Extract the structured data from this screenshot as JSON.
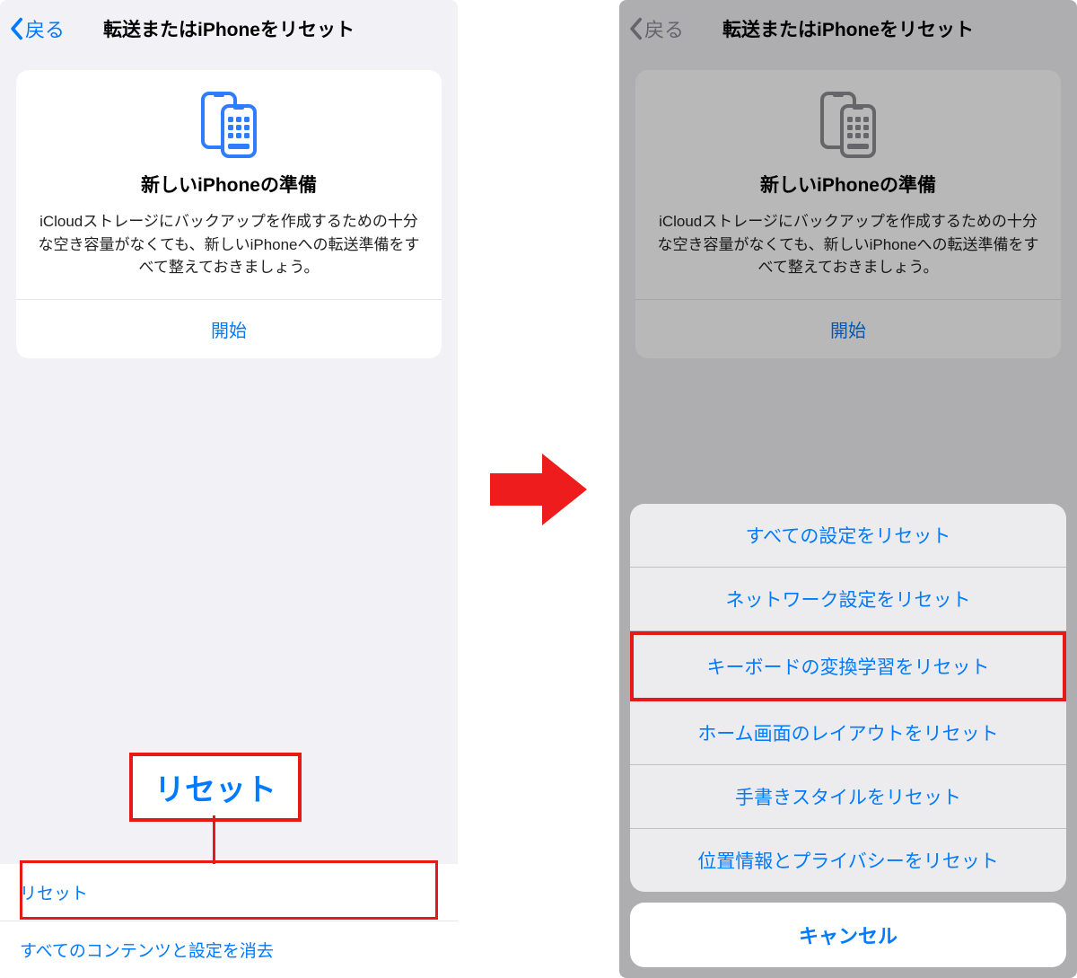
{
  "left": {
    "back_label": "戻る",
    "title": "転送またはiPhoneをリセット",
    "card": {
      "heading": "新しいiPhoneの準備",
      "description": "iCloudストレージにバックアップを作成するための十分な空き容量がなくても、新しいiPhoneへの転送準備をすべて整えておきましょう。",
      "action": "開始"
    },
    "callout_label": "リセット",
    "rows": {
      "reset": "リセット",
      "erase": "すべてのコンテンツと設定を消去"
    }
  },
  "right": {
    "back_label": "戻る",
    "title": "転送またはiPhoneをリセット",
    "card": {
      "heading": "新しいiPhoneの準備",
      "description": "iCloudストレージにバックアップを作成するための十分な空き容量がなくても、新しいiPhoneへの転送準備をすべて整えておきましょう。",
      "action": "開始"
    },
    "sheet": {
      "items": [
        "すべての設定をリセット",
        "ネットワーク設定をリセット",
        "キーボードの変換学習をリセット",
        "ホーム画面のレイアウトをリセット",
        "手書きスタイルをリセット",
        "位置情報とプライバシーをリセット"
      ],
      "cancel": "キャンセル"
    },
    "highlighted_index": 2
  },
  "colors": {
    "ios_blue": "#007aff",
    "annotation_red": "#e61919",
    "gray_bg": "#f2f2f6"
  }
}
